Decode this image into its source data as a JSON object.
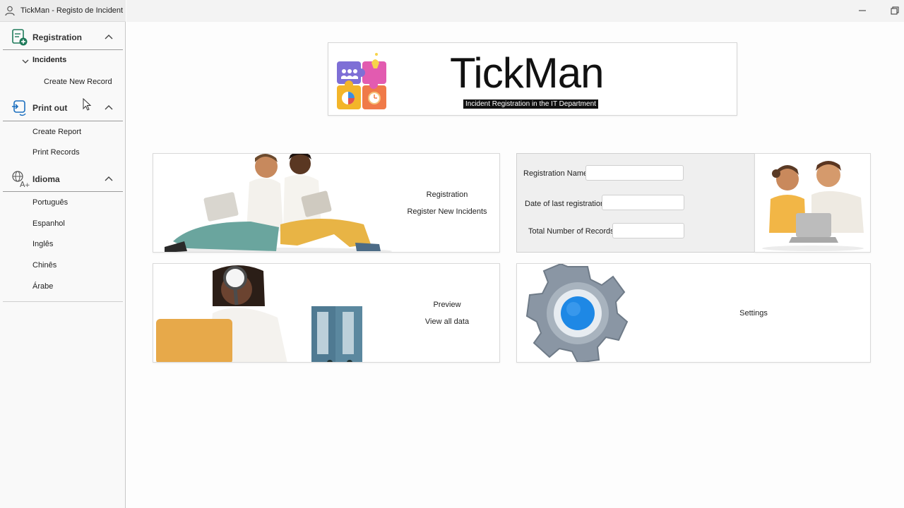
{
  "window": {
    "title": "TickMan - Registo de Incident..."
  },
  "sidebar": {
    "registration": {
      "label": "Registration",
      "group": "Incidents",
      "items": [
        "Create New Record"
      ]
    },
    "print_out": {
      "label": "Print out",
      "items": [
        "Create Report",
        "Print Records"
      ]
    },
    "language": {
      "label": "Idioma",
      "items": [
        "Português",
        "Espanhol",
        "Inglês",
        "Chinês",
        "Árabe"
      ]
    }
  },
  "logo": {
    "title": "TickMan",
    "subtitle": "Incident Registration in the IT Department"
  },
  "cards": {
    "registration": {
      "title": "Registration",
      "subtitle": "Register New Incidents"
    },
    "preview": {
      "title": "Preview",
      "subtitle": "View all data"
    },
    "settings": {
      "title": "Settings"
    }
  },
  "stats": {
    "registration_name_label": "Registration Name:",
    "registration_name_value": "",
    "last_date_label": "Date of last registration:",
    "last_date_value": "",
    "total_label": "Total Number of Records:",
    "total_value": ""
  },
  "colors": {
    "accent": "#1b6fbf",
    "registration_icon": "#1f7a5a",
    "gear_blue": "#1e88e5"
  }
}
